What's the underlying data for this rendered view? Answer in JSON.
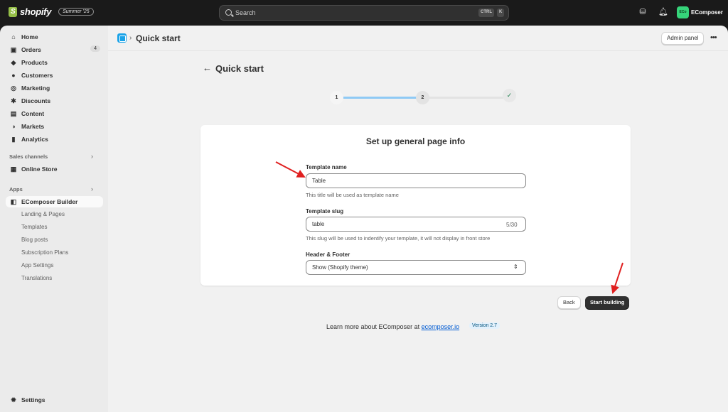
{
  "topbar": {
    "logo_text": "shopify",
    "summer_badge": "Summer '25",
    "search_placeholder": "Search",
    "kbd_ctrl": "CTRL",
    "kbd_k": "K",
    "store_avatar": "ECo",
    "store_name": "EComposer"
  },
  "sidebar": {
    "items": [
      {
        "label": "Home",
        "icon": "⌂"
      },
      {
        "label": "Orders",
        "icon": "▣",
        "badge": "4"
      },
      {
        "label": "Products",
        "icon": "◆"
      },
      {
        "label": "Customers",
        "icon": "●"
      },
      {
        "label": "Marketing",
        "icon": "◎"
      },
      {
        "label": "Discounts",
        "icon": "✱"
      },
      {
        "label": "Content",
        "icon": "▤"
      },
      {
        "label": "Markets",
        "icon": "◑"
      },
      {
        "label": "Analytics",
        "icon": "▮"
      }
    ],
    "sales_channels_label": "Sales channels",
    "online_store_label": "Online Store",
    "apps_label": "Apps",
    "app_name": "EComposer Builder",
    "app_subitems": [
      "Landing & Pages",
      "Templates",
      "Blog posts",
      "Subscription Plans",
      "App Settings",
      "Translations"
    ],
    "settings_label": "Settings"
  },
  "header": {
    "title": "Quick start",
    "admin_panel_label": "Admin panel",
    "more_label": "•••"
  },
  "page": {
    "title": "Quick start",
    "step1": "1",
    "step2": "2",
    "card_title": "Set up general page info",
    "template_name_label": "Template name",
    "template_name_value": "Table",
    "template_name_help": "This title will be used as template name",
    "template_slug_label": "Template slug",
    "template_slug_value": "table",
    "template_slug_counter": "5/30",
    "template_slug_help": "This slug will be used to indentify your template, it will not display in front store",
    "header_footer_label": "Header & Footer",
    "header_footer_value": "Show (Shopify theme)",
    "back_label": "Back",
    "start_label": "Start building",
    "footer_prefix": "Learn more about EComposer at ",
    "footer_link": "ecomposer.io",
    "version": "Version 2.7"
  },
  "colors": {
    "progress_fill": "#8fcaf5",
    "progress_empty": "#e3e3e3",
    "annotation_arrow": "#e02020"
  }
}
